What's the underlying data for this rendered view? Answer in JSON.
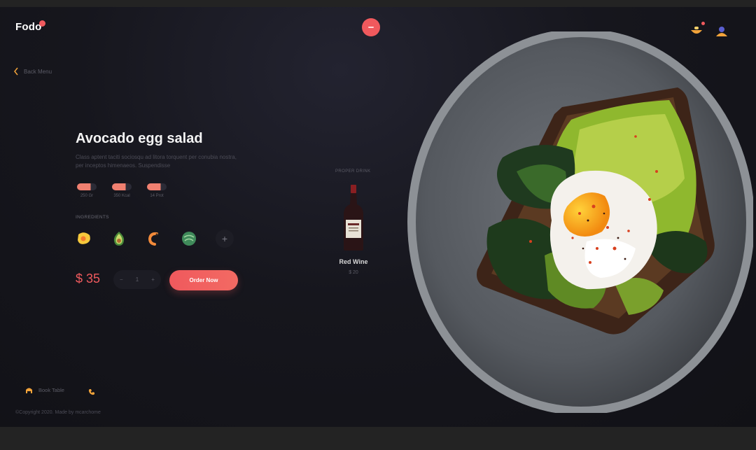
{
  "brand": {
    "logo": "Fodo",
    "accent": "#f0595d"
  },
  "nav": {
    "back_label": "Back Menu"
  },
  "product": {
    "title": "Avocado egg salad",
    "description": "Class aptent taciti sociosqu ad litora torquent per conubia nostra, per inceptos himenaeos. Suspendisse",
    "stats": [
      {
        "label": "250 Gr",
        "icon": "weight-icon"
      },
      {
        "label": "350 Kcal",
        "icon": "calories-icon"
      },
      {
        "label": "14 Prot",
        "icon": "protein-icon"
      }
    ],
    "ingredients_label": "INGREDIENTS",
    "ingredients": [
      "egg-icon",
      "avocado-icon",
      "shrimp-icon",
      "cabbage-icon"
    ],
    "price": "$ 35",
    "quantity": "1",
    "qty_minus": "−",
    "qty_plus": "+",
    "order_label": "Order Now"
  },
  "drink": {
    "section_label": "PROPER DRINK",
    "name": "Red Wine",
    "price": "$ 20"
  },
  "footer": {
    "book_table": "Book Table",
    "copyright": "©Copyright 2020. Made by mcarchome"
  }
}
